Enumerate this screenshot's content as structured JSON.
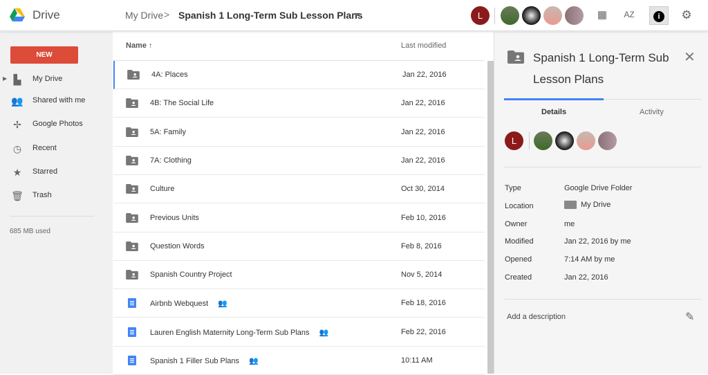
{
  "header": {
    "brand": "Drive",
    "breadcrumb_root": "My Drive",
    "breadcrumb_sep": ">",
    "breadcrumb_current": "Spanish 1 Long-Term Sub Lesson Plans",
    "user_initial": "L",
    "icons": [
      "grid-view-icon",
      "sort-az-icon",
      "info-icon",
      "settings-icon"
    ]
  },
  "sidebar": {
    "new_label": "NEW",
    "items": [
      {
        "label": "My Drive",
        "icon": "my-drive-icon"
      },
      {
        "label": "Shared with me",
        "icon": "people-icon"
      },
      {
        "label": "Google Photos",
        "icon": "photos-icon"
      },
      {
        "label": "Recent",
        "icon": "clock-icon"
      },
      {
        "label": "Starred",
        "icon": "star-icon"
      },
      {
        "label": "Trash",
        "icon": "trash-icon"
      }
    ],
    "storage": "685 MB used"
  },
  "list": {
    "col_name": "Name",
    "col_modified": "Last modified",
    "rows": [
      {
        "name": "4A: Places",
        "modified": "Jan 22, 2016",
        "type": "shared-folder",
        "shared": false
      },
      {
        "name": "4B: The Social Life",
        "modified": "Jan 22, 2016",
        "type": "shared-folder",
        "shared": false
      },
      {
        "name": "5A: Family",
        "modified": "Jan 22, 2016",
        "type": "shared-folder",
        "shared": false
      },
      {
        "name": "7A: Clothing",
        "modified": "Jan 22, 2016",
        "type": "shared-folder",
        "shared": false
      },
      {
        "name": "Culture",
        "modified": "Oct 30, 2014",
        "type": "shared-folder",
        "shared": false
      },
      {
        "name": "Previous Units",
        "modified": "Feb 10, 2016",
        "type": "shared-folder",
        "shared": false
      },
      {
        "name": "Question Words",
        "modified": "Feb 8, 2016",
        "type": "shared-folder",
        "shared": false
      },
      {
        "name": "Spanish Country Project",
        "modified": "Nov 5, 2014",
        "type": "shared-folder",
        "shared": false
      },
      {
        "name": "Airbnb Webquest",
        "modified": "Feb 18, 2016",
        "type": "doc",
        "shared": true
      },
      {
        "name": "Lauren English Maternity Long-Term Sub Plans",
        "modified": "Feb 22, 2016",
        "type": "doc",
        "shared": true
      },
      {
        "name": "Spanish 1 Filler Sub Plans",
        "modified": "10:11 AM",
        "type": "doc",
        "shared": true
      }
    ]
  },
  "panel": {
    "title": "Spanish 1 Long-Term Sub Lesson Plans",
    "tab_details": "Details",
    "tab_activity": "Activity",
    "user_initial": "L",
    "details": [
      {
        "label": "Type",
        "value": "Google Drive Folder"
      },
      {
        "label": "Location",
        "value": "My Drive"
      },
      {
        "label": "Owner",
        "value": "me"
      },
      {
        "label": "Modified",
        "value": "Jan 22, 2016 by me"
      },
      {
        "label": "Opened",
        "value": "7:14 AM by me"
      },
      {
        "label": "Created",
        "value": "Jan 22, 2016"
      }
    ],
    "add_description": "Add a description"
  },
  "colors": {
    "accent": "#4285f4",
    "new_button": "#dd4b39",
    "avatar": "#8b1a1a"
  }
}
